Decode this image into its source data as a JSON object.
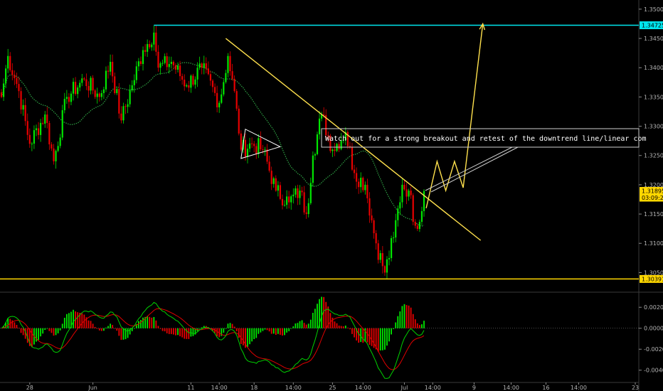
{
  "chart_data": {
    "type": "candlestick",
    "symbol_pair_note": "",
    "price_axis": {
      "ylim": [
        1.3025,
        1.3512
      ],
      "ticks": [
        "1.35000",
        "1.34500",
        "1.34000",
        "1.33500",
        "1.33000",
        "1.32500",
        "1.32000",
        "1.31500",
        "1.31000",
        "1.30500"
      ],
      "tick_values": [
        1.35,
        1.345,
        1.34,
        1.335,
        1.33,
        1.325,
        1.32,
        1.315,
        1.31,
        1.305
      ]
    },
    "price_labels": [
      {
        "text": "1.34725",
        "value": 1.34725,
        "color": "#00e5ee"
      },
      {
        "text": "1.31895",
        "value": 1.31895,
        "color": "#ffd700"
      },
      {
        "text": "03:09:29",
        "value": 1.3178,
        "color": "#ffd700"
      },
      {
        "text": "1.30391",
        "value": 1.30391,
        "color": "#ffd700"
      }
    ],
    "osc_axis": {
      "ylim": [
        -0.0049,
        0.0031
      ],
      "ticks": [
        "0.0020",
        "0.0000",
        "-0.0020",
        "-0.0040"
      ],
      "tick_values": [
        0.002,
        0.0,
        -0.002,
        -0.004
      ]
    },
    "time_axis": {
      "labels": [
        "28",
        "Jun",
        "11",
        "14:00",
        "18",
        "14:00",
        "25",
        "14:00",
        "Jul",
        "14:00",
        "9",
        "14:00",
        "16",
        "14:00",
        "23"
      ],
      "index": [
        13,
        42,
        87,
        100,
        116,
        134,
        152,
        166,
        185,
        198,
        217,
        234,
        250,
        265,
        291
      ]
    },
    "horizontal_levels": [
      {
        "value": 1.34725,
        "color": "#00e5ee"
      },
      {
        "value": 1.30391,
        "color": "#ffd700"
      }
    ],
    "annotation": "Watch out for a strong breakout and retest of the downtrend line/linear com",
    "colors": {
      "up": "#00e600",
      "down": "#e60000",
      "ma": "#2ea043",
      "trendline": "#ffe14d",
      "macd": "#00d000",
      "signal": "#e00000",
      "axis_text": "#b4b4b4"
    },
    "anchors": [
      [
        0,
        1.335
      ],
      [
        3,
        1.342
      ],
      [
        8,
        1.336
      ],
      [
        13,
        1.327
      ],
      [
        20,
        1.332
      ],
      [
        24,
        1.324
      ],
      [
        30,
        1.335
      ],
      [
        38,
        1.338
      ],
      [
        45,
        1.335
      ],
      [
        50,
        1.341
      ],
      [
        55,
        1.331
      ],
      [
        60,
        1.337
      ],
      [
        65,
        1.343
      ],
      [
        70,
        1.346
      ],
      [
        72,
        1.34
      ],
      [
        78,
        1.341
      ],
      [
        85,
        1.337
      ],
      [
        92,
        1.34
      ],
      [
        100,
        1.334
      ],
      [
        104,
        1.342
      ],
      [
        108,
        1.333
      ],
      [
        110,
        1.326
      ],
      [
        115,
        1.327
      ],
      [
        120,
        1.326
      ],
      [
        126,
        1.319
      ],
      [
        132,
        1.317
      ],
      [
        137,
        1.319
      ],
      [
        140,
        1.315
      ],
      [
        143,
        1.325
      ],
      [
        147,
        1.332
      ],
      [
        152,
        1.326
      ],
      [
        158,
        1.329
      ],
      [
        162,
        1.322
      ],
      [
        167,
        1.32
      ],
      [
        172,
        1.31
      ],
      [
        176,
        1.305
      ],
      [
        180,
        1.311
      ],
      [
        184,
        1.32
      ],
      [
        187,
        1.319
      ],
      [
        190,
        1.313
      ],
      [
        193,
        1.3155
      ],
      [
        194,
        1.31895
      ]
    ],
    "arrow_path": [
      [
        195,
        1.316
      ],
      [
        200,
        1.324
      ],
      [
        204,
        1.319
      ],
      [
        208,
        1.324
      ],
      [
        212,
        1.3195
      ],
      [
        221,
        1.3475
      ]
    ]
  }
}
